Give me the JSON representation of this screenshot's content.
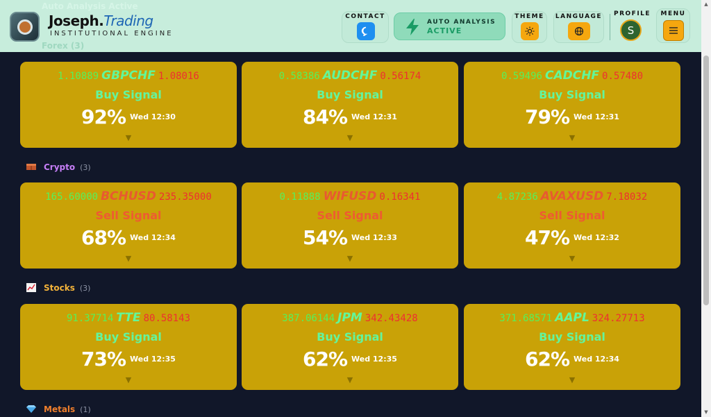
{
  "header": {
    "ghost_text": "Auto Analysis Active",
    "ghost_sub": "Forex (3)",
    "brand_name": "Joseph.",
    "brand_accent": "Trading",
    "brand_subtitle": "INSTITUTIONAL ENGINE",
    "contact_label": "CONTACT",
    "auto_title": "AUTO ANALYSIS",
    "auto_state": "ACTIVE",
    "theme_label": "THEME",
    "language_label": "LANGUAGE",
    "profile_label": "PROFILE",
    "profile_initial": "S",
    "menu_label": "MENU"
  },
  "colors": {
    "card_bg": "#c9a207",
    "buy": "#63f59e",
    "sell": "#ee5b32",
    "low_price": "#56f25b",
    "high_price": "#ee2f31",
    "icon_orange": "#f5a70f",
    "contact_blue": "#1e8ff0"
  },
  "sections": [
    {
      "name": "Crypto",
      "count": "(3)",
      "icon": "crypto-brick-icon",
      "color": "#c67ef7",
      "cards": [
        {
          "low": "165.60000",
          "symbol": "BCHUSD",
          "high": "235.35000",
          "signal": "Sell Signal",
          "type": "sell",
          "pct": "68%",
          "time": "Wed 12:34"
        },
        {
          "low": "0.11888",
          "symbol": "WIFUSD",
          "high": "0.16341",
          "signal": "Sell Signal",
          "type": "sell",
          "pct": "54%",
          "time": "Wed 12:33"
        },
        {
          "low": "4.87236",
          "symbol": "AVAXUSD",
          "high": "7.18032",
          "signal": "Sell Signal",
          "type": "sell",
          "pct": "47%",
          "time": "Wed 12:32"
        }
      ]
    },
    {
      "name": "Stocks",
      "count": "(3)",
      "icon": "chart-up-icon",
      "color": "#f2b23a",
      "cards": [
        {
          "low": "91.37714",
          "symbol": "TTE",
          "high": "80.58143",
          "signal": "Buy Signal",
          "type": "buy",
          "pct": "73%",
          "time": "Wed 12:35"
        },
        {
          "low": "387.06144",
          "symbol": "JPM",
          "high": "342.43428",
          "signal": "Buy Signal",
          "type": "buy",
          "pct": "62%",
          "time": "Wed 12:35"
        },
        {
          "low": "371.68571",
          "symbol": "AAPL",
          "high": "324.27713",
          "signal": "Buy Signal",
          "type": "buy",
          "pct": "62%",
          "time": "Wed 12:34"
        }
      ]
    },
    {
      "name": "Metals",
      "count": "(1)",
      "icon": "gem-icon",
      "color": "#f07f2c",
      "cards": []
    }
  ],
  "forex_cards": [
    {
      "low": "1.10889",
      "symbol": "GBPCHF",
      "high": "1.08016",
      "signal": "Buy Signal",
      "type": "buy",
      "pct": "92%",
      "time": "Wed 12:30"
    },
    {
      "low": "0.58386",
      "symbol": "AUDCHF",
      "high": "0.56174",
      "signal": "Buy Signal",
      "type": "buy",
      "pct": "84%",
      "time": "Wed 12:31"
    },
    {
      "low": "0.59496",
      "symbol": "CADCHF",
      "high": "0.57480",
      "signal": "Buy Signal",
      "type": "buy",
      "pct": "79%",
      "time": "Wed 12:31"
    }
  ],
  "chevron": "▼"
}
